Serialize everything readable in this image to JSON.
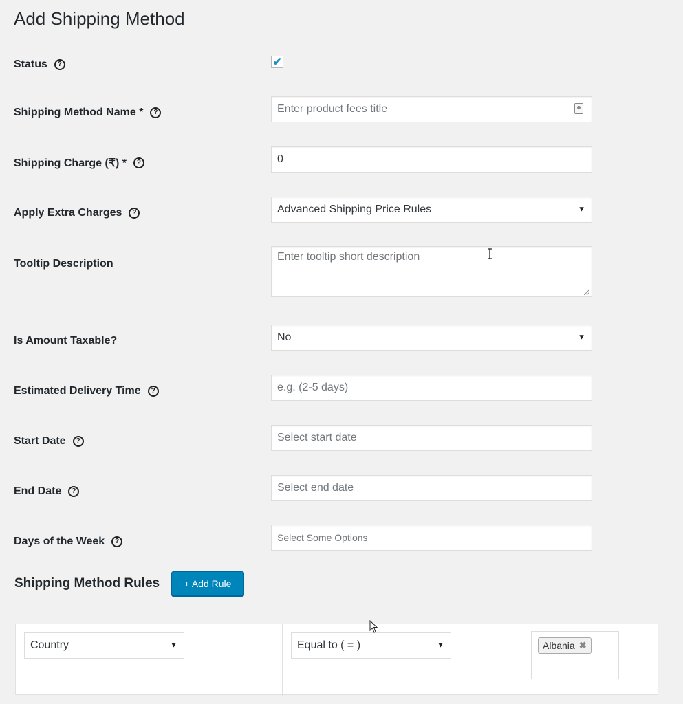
{
  "page": {
    "title": "Add Shipping Method"
  },
  "fields": {
    "status": {
      "label": "Status",
      "checked": true
    },
    "method_name": {
      "label": "Shipping Method Name *",
      "placeholder": "Enter product fees title"
    },
    "charge": {
      "label": "Shipping Charge (₹) *",
      "value": "0"
    },
    "extra_charges": {
      "label": "Apply Extra Charges",
      "value": "Advanced Shipping Price Rules"
    },
    "tooltip": {
      "label": "Tooltip Description",
      "placeholder": "Enter tooltip short description"
    },
    "taxable": {
      "label": "Is Amount Taxable?",
      "value": "No"
    },
    "delivery": {
      "label": "Estimated Delivery Time",
      "placeholder": "e.g. (2-5 days)"
    },
    "start_date": {
      "label": "Start Date",
      "placeholder": "Select start date"
    },
    "end_date": {
      "label": "End Date",
      "placeholder": "Select end date"
    },
    "days": {
      "label": "Days of the Week",
      "placeholder": "Select Some Options"
    }
  },
  "rules": {
    "title": "Shipping Method Rules",
    "add_button": "+ Add Rule",
    "rows": [
      {
        "condition": "Country",
        "operator": "Equal to ( = )",
        "values": [
          "Albania"
        ]
      }
    ]
  },
  "icons": {
    "help": "question-circle-icon",
    "checkbox_mark": "✔",
    "caret": "▼",
    "remove": "✖"
  },
  "colors": {
    "accent": "#0085ba",
    "check": "#1e8cbe",
    "background": "#f1f1f1"
  }
}
